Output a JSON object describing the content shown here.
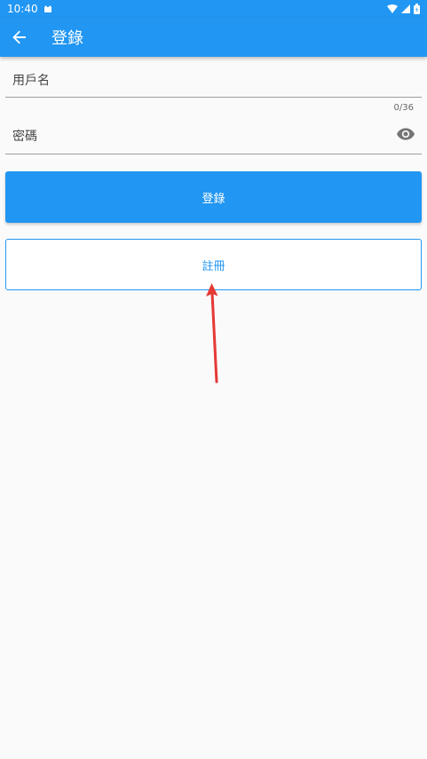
{
  "status_bar": {
    "time": "10:40",
    "icons": [
      "notification-icon",
      "wifi-icon",
      "signal-icon",
      "battery-icon"
    ]
  },
  "app_bar": {
    "title": "登錄",
    "back_icon": "arrow-left-icon"
  },
  "form": {
    "username": {
      "label": "用戶名",
      "counter": "0/36"
    },
    "password": {
      "label": "密碼",
      "toggle_icon": "eye-icon"
    }
  },
  "buttons": {
    "login": "登錄",
    "register": "註冊"
  },
  "annotation": {
    "arrow_color": "#e53935"
  },
  "colors": {
    "primary": "#2196f3",
    "background": "#fafafa"
  }
}
